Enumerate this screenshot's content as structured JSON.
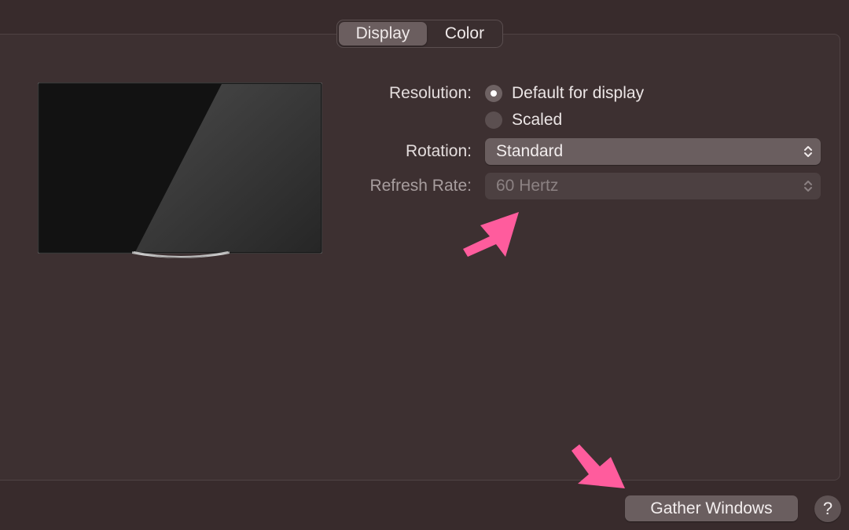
{
  "tabs": [
    {
      "label": "Display",
      "selected": true
    },
    {
      "label": "Color",
      "selected": false
    }
  ],
  "form": {
    "resolution_label": "Resolution:",
    "resolution_options": [
      {
        "label": "Default for display",
        "selected": true
      },
      {
        "label": "Scaled",
        "selected": false
      }
    ],
    "rotation_label": "Rotation:",
    "rotation_value": "Standard",
    "refresh_label": "Refresh Rate:",
    "refresh_value": "60 Hertz",
    "refresh_enabled": false
  },
  "footer": {
    "gather_label": "Gather Windows",
    "help_label": "?"
  },
  "icons": {
    "monitor": "display-monitor-icon",
    "popup_arrows": "chevron-up-down-icon",
    "annotation": "pink-arrow-icon"
  },
  "colors": {
    "background": "#382b2c",
    "panel": "#3d3031",
    "control": "#6a5e5f",
    "annotation_arrow": "#ff5c9d"
  }
}
